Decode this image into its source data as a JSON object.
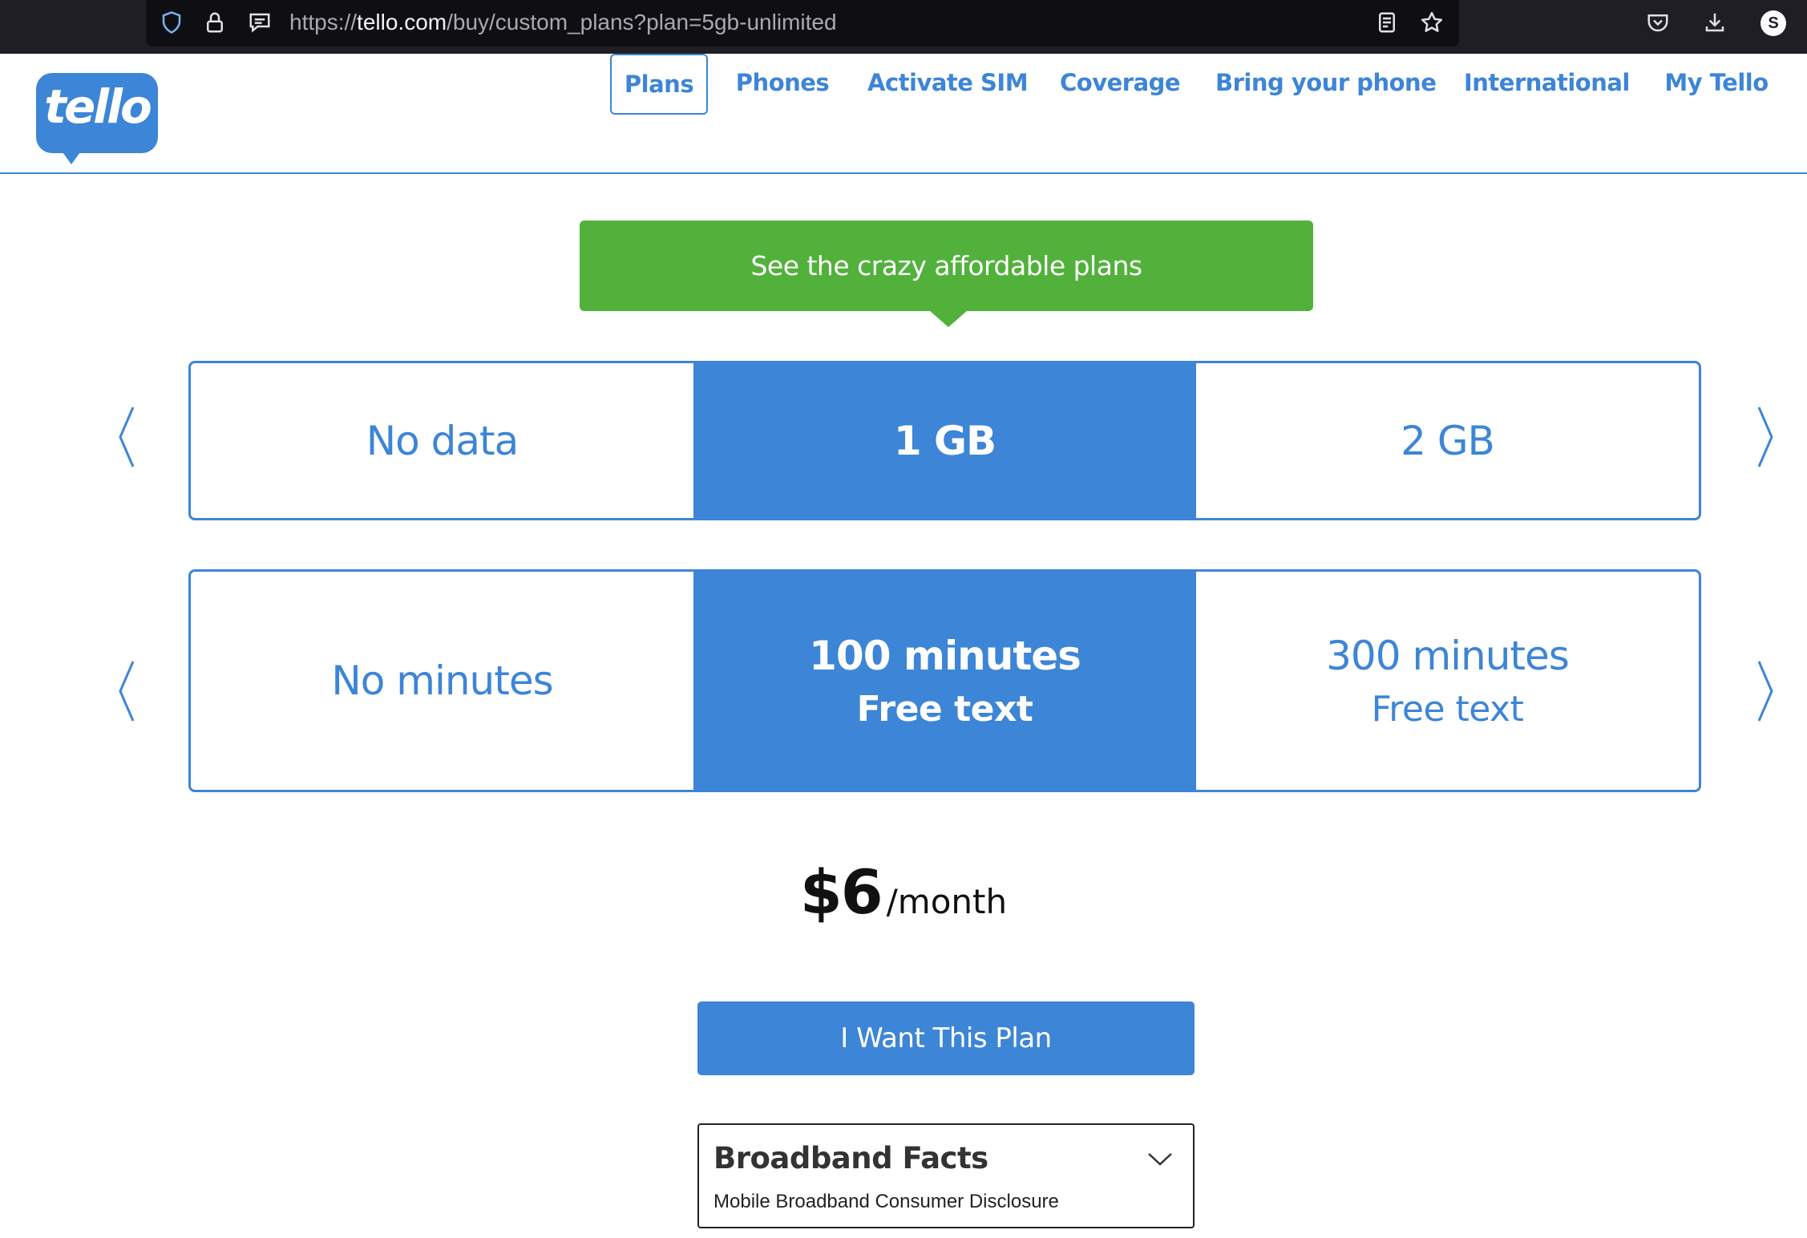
{
  "browser": {
    "url_prefix": "https://",
    "url_host": "tello.com",
    "url_path": "/buy/custom_plans?plan=5gb-unlimited",
    "profile_initial": "S"
  },
  "header": {
    "logo_text": "tello",
    "nav": [
      {
        "label": "Plans",
        "active": true
      },
      {
        "label": "Phones"
      },
      {
        "label": "Activate SIM"
      },
      {
        "label": "Coverage"
      },
      {
        "label": "Bring your phone"
      },
      {
        "label": "International"
      },
      {
        "label": "My Tello"
      }
    ]
  },
  "banner": {
    "text": "See the crazy affordable plans"
  },
  "data_selector": {
    "options": [
      {
        "label": "No data"
      },
      {
        "label": "1 GB",
        "selected": true
      },
      {
        "label": "2 GB"
      }
    ]
  },
  "minutes_selector": {
    "options": [
      {
        "label": "No minutes",
        "sub": ""
      },
      {
        "label": "100 minutes",
        "sub": "Free text",
        "selected": true
      },
      {
        "label": "300 minutes",
        "sub": "Free text"
      }
    ]
  },
  "price": {
    "amount": "$6",
    "unit": "/month"
  },
  "cta": {
    "label": "I Want This Plan"
  },
  "broadband_facts": {
    "title": "Broadband Facts",
    "subtitle": "Mobile Broadband Consumer Disclosure"
  },
  "colors": {
    "brand_blue": "#3d85d6",
    "banner_green": "#52b13b"
  }
}
